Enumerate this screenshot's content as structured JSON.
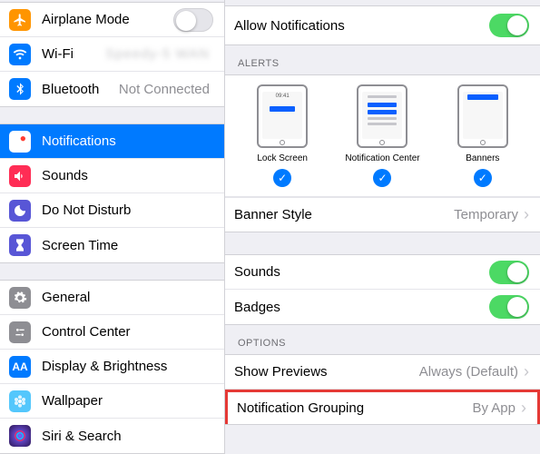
{
  "left": {
    "group1": [
      {
        "label": "Airplane Mode",
        "value": "",
        "toggle": "off",
        "iconBg": "#ff9500",
        "icon": "airplane"
      },
      {
        "label": "Wi-Fi",
        "value": "Speedy-5 WAN",
        "blurred": true,
        "iconBg": "#007aff",
        "icon": "wifi"
      },
      {
        "label": "Bluetooth",
        "value": "Not Connected",
        "iconBg": "#007aff",
        "icon": "bluetooth"
      }
    ],
    "group2": [
      {
        "label": "Notifications",
        "selected": true,
        "iconBg": "#ff3b30",
        "icon": "notifications"
      },
      {
        "label": "Sounds",
        "iconBg": "#ff2d55",
        "icon": "sounds"
      },
      {
        "label": "Do Not Disturb",
        "iconBg": "#5856d6",
        "icon": "moon"
      },
      {
        "label": "Screen Time",
        "iconBg": "#5856d6",
        "icon": "hourglass"
      }
    ],
    "group3": [
      {
        "label": "General",
        "iconBg": "#8e8e93",
        "icon": "gear"
      },
      {
        "label": "Control Center",
        "iconBg": "#8e8e93",
        "icon": "controls"
      },
      {
        "label": "Display & Brightness",
        "iconBg": "#007aff",
        "icon": "aa"
      },
      {
        "label": "Wallpaper",
        "iconBg": "#54c7fc",
        "icon": "flower"
      },
      {
        "label": "Siri & Search",
        "iconBg": "#1c1c1e",
        "icon": "siri"
      }
    ]
  },
  "right": {
    "allow_label": "Allow Notifications",
    "alerts_header": "ALERTS",
    "alerts": {
      "lock": "Lock Screen",
      "center": "Notification Center",
      "banners": "Banners",
      "time": "09:41"
    },
    "banner_style_label": "Banner Style",
    "banner_style_value": "Temporary",
    "sounds_label": "Sounds",
    "badges_label": "Badges",
    "options_header": "OPTIONS",
    "previews_label": "Show Previews",
    "previews_value": "Always (Default)",
    "grouping_label": "Notification Grouping",
    "grouping_value": "By App"
  },
  "colors": {
    "accent": "#007aff",
    "green": "#4cd964"
  }
}
